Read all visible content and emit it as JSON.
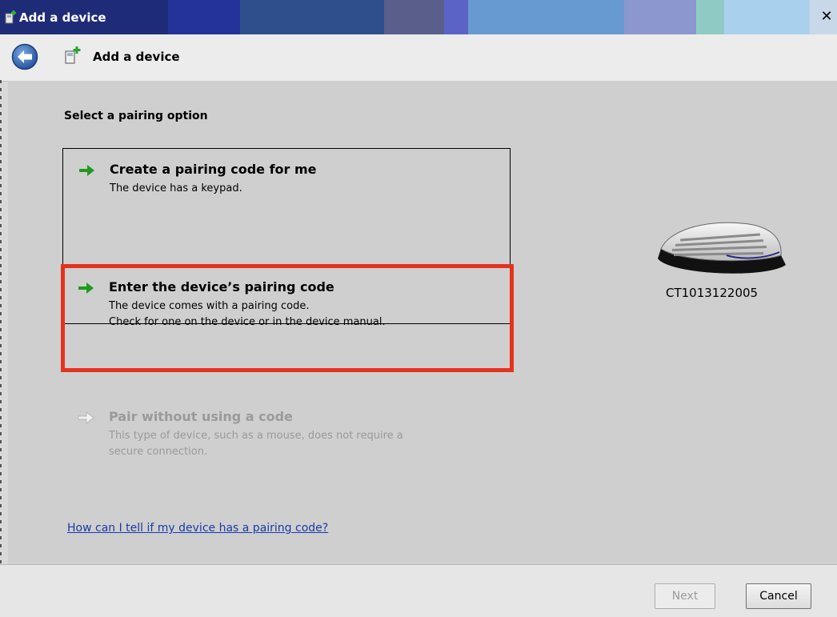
{
  "window": {
    "title": "Add a device",
    "close_glyph": "✕"
  },
  "nav": {
    "back_icon": "back-arrow-icon",
    "title": "Add a device"
  },
  "main": {
    "heading": "Select a pairing option",
    "options": [
      {
        "title": "Create a pairing code for me",
        "description": [
          "The device has a keypad."
        ],
        "enabled": true,
        "arrow_color": "#1e9b1e"
      },
      {
        "title": "Enter the device’s pairing code",
        "description": [
          "The device comes with a pairing code.",
          "Check for one on the device or in the device manual."
        ],
        "enabled": true,
        "highlighted": true,
        "highlight_color": "#e5321e",
        "arrow_color": "#1e9b1e"
      },
      {
        "title": "Pair without using a code",
        "description": [
          "This type of device, such as a mouse, does not require a",
          "secure connection."
        ],
        "enabled": false,
        "arrow_color": "#b4b4b4"
      }
    ],
    "help_link": "How can I tell if my device has a pairing code?",
    "device": {
      "icon": "keyboard-icon",
      "name": "CT1013122005"
    }
  },
  "footer": {
    "next_label": "Next",
    "next_enabled": false,
    "cancel_label": "Cancel"
  }
}
